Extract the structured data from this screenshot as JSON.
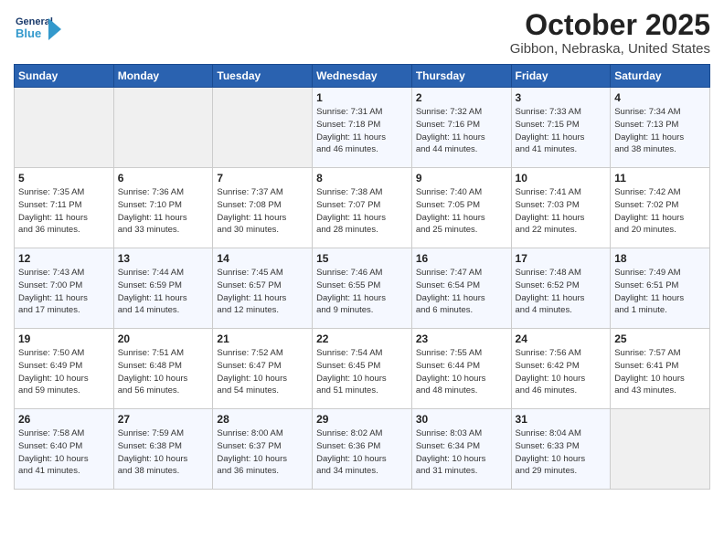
{
  "header": {
    "logo_general": "General",
    "logo_blue": "Blue",
    "month_title": "October 2025",
    "location": "Gibbon, Nebraska, United States"
  },
  "weekdays": [
    "Sunday",
    "Monday",
    "Tuesday",
    "Wednesday",
    "Thursday",
    "Friday",
    "Saturday"
  ],
  "weeks": [
    [
      {
        "day": "",
        "info": ""
      },
      {
        "day": "",
        "info": ""
      },
      {
        "day": "",
        "info": ""
      },
      {
        "day": "1",
        "info": "Sunrise: 7:31 AM\nSunset: 7:18 PM\nDaylight: 11 hours\nand 46 minutes."
      },
      {
        "day": "2",
        "info": "Sunrise: 7:32 AM\nSunset: 7:16 PM\nDaylight: 11 hours\nand 44 minutes."
      },
      {
        "day": "3",
        "info": "Sunrise: 7:33 AM\nSunset: 7:15 PM\nDaylight: 11 hours\nand 41 minutes."
      },
      {
        "day": "4",
        "info": "Sunrise: 7:34 AM\nSunset: 7:13 PM\nDaylight: 11 hours\nand 38 minutes."
      }
    ],
    [
      {
        "day": "5",
        "info": "Sunrise: 7:35 AM\nSunset: 7:11 PM\nDaylight: 11 hours\nand 36 minutes."
      },
      {
        "day": "6",
        "info": "Sunrise: 7:36 AM\nSunset: 7:10 PM\nDaylight: 11 hours\nand 33 minutes."
      },
      {
        "day": "7",
        "info": "Sunrise: 7:37 AM\nSunset: 7:08 PM\nDaylight: 11 hours\nand 30 minutes."
      },
      {
        "day": "8",
        "info": "Sunrise: 7:38 AM\nSunset: 7:07 PM\nDaylight: 11 hours\nand 28 minutes."
      },
      {
        "day": "9",
        "info": "Sunrise: 7:40 AM\nSunset: 7:05 PM\nDaylight: 11 hours\nand 25 minutes."
      },
      {
        "day": "10",
        "info": "Sunrise: 7:41 AM\nSunset: 7:03 PM\nDaylight: 11 hours\nand 22 minutes."
      },
      {
        "day": "11",
        "info": "Sunrise: 7:42 AM\nSunset: 7:02 PM\nDaylight: 11 hours\nand 20 minutes."
      }
    ],
    [
      {
        "day": "12",
        "info": "Sunrise: 7:43 AM\nSunset: 7:00 PM\nDaylight: 11 hours\nand 17 minutes."
      },
      {
        "day": "13",
        "info": "Sunrise: 7:44 AM\nSunset: 6:59 PM\nDaylight: 11 hours\nand 14 minutes."
      },
      {
        "day": "14",
        "info": "Sunrise: 7:45 AM\nSunset: 6:57 PM\nDaylight: 11 hours\nand 12 minutes."
      },
      {
        "day": "15",
        "info": "Sunrise: 7:46 AM\nSunset: 6:55 PM\nDaylight: 11 hours\nand 9 minutes."
      },
      {
        "day": "16",
        "info": "Sunrise: 7:47 AM\nSunset: 6:54 PM\nDaylight: 11 hours\nand 6 minutes."
      },
      {
        "day": "17",
        "info": "Sunrise: 7:48 AM\nSunset: 6:52 PM\nDaylight: 11 hours\nand 4 minutes."
      },
      {
        "day": "18",
        "info": "Sunrise: 7:49 AM\nSunset: 6:51 PM\nDaylight: 11 hours\nand 1 minute."
      }
    ],
    [
      {
        "day": "19",
        "info": "Sunrise: 7:50 AM\nSunset: 6:49 PM\nDaylight: 10 hours\nand 59 minutes."
      },
      {
        "day": "20",
        "info": "Sunrise: 7:51 AM\nSunset: 6:48 PM\nDaylight: 10 hours\nand 56 minutes."
      },
      {
        "day": "21",
        "info": "Sunrise: 7:52 AM\nSunset: 6:47 PM\nDaylight: 10 hours\nand 54 minutes."
      },
      {
        "day": "22",
        "info": "Sunrise: 7:54 AM\nSunset: 6:45 PM\nDaylight: 10 hours\nand 51 minutes."
      },
      {
        "day": "23",
        "info": "Sunrise: 7:55 AM\nSunset: 6:44 PM\nDaylight: 10 hours\nand 48 minutes."
      },
      {
        "day": "24",
        "info": "Sunrise: 7:56 AM\nSunset: 6:42 PM\nDaylight: 10 hours\nand 46 minutes."
      },
      {
        "day": "25",
        "info": "Sunrise: 7:57 AM\nSunset: 6:41 PM\nDaylight: 10 hours\nand 43 minutes."
      }
    ],
    [
      {
        "day": "26",
        "info": "Sunrise: 7:58 AM\nSunset: 6:40 PM\nDaylight: 10 hours\nand 41 minutes."
      },
      {
        "day": "27",
        "info": "Sunrise: 7:59 AM\nSunset: 6:38 PM\nDaylight: 10 hours\nand 38 minutes."
      },
      {
        "day": "28",
        "info": "Sunrise: 8:00 AM\nSunset: 6:37 PM\nDaylight: 10 hours\nand 36 minutes."
      },
      {
        "day": "29",
        "info": "Sunrise: 8:02 AM\nSunset: 6:36 PM\nDaylight: 10 hours\nand 34 minutes."
      },
      {
        "day": "30",
        "info": "Sunrise: 8:03 AM\nSunset: 6:34 PM\nDaylight: 10 hours\nand 31 minutes."
      },
      {
        "day": "31",
        "info": "Sunrise: 8:04 AM\nSunset: 6:33 PM\nDaylight: 10 hours\nand 29 minutes."
      },
      {
        "day": "",
        "info": ""
      }
    ]
  ]
}
